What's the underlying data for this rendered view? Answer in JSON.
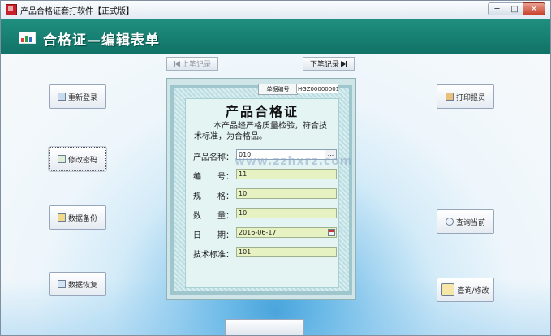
{
  "window": {
    "title": "产品合格证套打软件【正式版】",
    "min_label": "─",
    "max_label": "□",
    "close_label": "✕"
  },
  "header": {
    "title": "合格证—编辑表单",
    "icon": "bar-chart-icon"
  },
  "nav": {
    "prev_label": "上笔记录",
    "next_label": "下笔记录"
  },
  "left_buttons": [
    {
      "label": "重新登录",
      "icon": "login-icon"
    },
    {
      "label": "修改密码",
      "icon": "key-user-icon"
    },
    {
      "label": "数据备份",
      "icon": "backup-icon"
    },
    {
      "label": "数据恢复",
      "icon": "restore-icon"
    }
  ],
  "right_buttons": [
    {
      "label": "打印报员",
      "icon": "printer-icon"
    },
    {
      "label": "查询当前",
      "icon": "search-icon"
    },
    {
      "label": "查询/修改",
      "icon": "search-large-icon"
    }
  ],
  "certificate": {
    "serial_label": "单据编号",
    "serial_value": "HGZ00000001",
    "title": "产品合格证",
    "description": "本产品经严格质量检验，符合技术标准，为合格品。",
    "fields": [
      {
        "label": "产品名称：",
        "value": "010"
      },
      {
        "label": "编　　号：",
        "value": "11"
      },
      {
        "label": "规　　格：",
        "value": "10"
      },
      {
        "label": "数　　量：",
        "value": "10"
      },
      {
        "label": "日　　期：",
        "value": "2016-06-17"
      },
      {
        "label": "技术标准：",
        "value": "101"
      }
    ]
  },
  "watermark": "www.zzhxrz.com",
  "colors": {
    "header_bg": "#107266",
    "field_bg": "#e7f2c2",
    "cert_bg": "#e3f4f3"
  }
}
